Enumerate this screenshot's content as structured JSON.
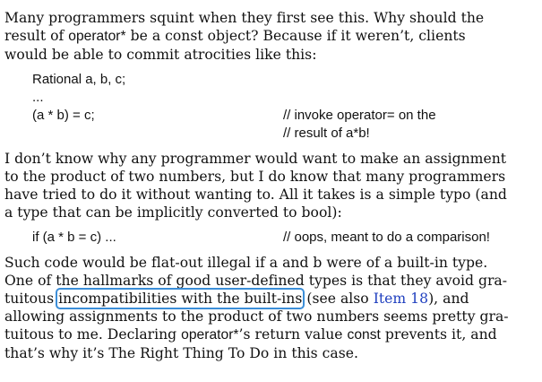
{
  "para1": {
    "l1": "Many programmers squint when they first see this. Why should the",
    "l2a": "result of ",
    "l2b": "operator*",
    "l2c": " be a const object? Because if it weren’t, clients",
    "l3": "would be able to commit atrocities like this:"
  },
  "code1": {
    "line1": "Rational a, b, c;",
    "line2": "...",
    "line3": "(a * b) = c;",
    "comment3": "// invoke operator= on the",
    "comment4": "// result of a*b!"
  },
  "para2": {
    "l1": "I don’t know why any programmer would want to make an assignment",
    "l2": "to the product of two numbers, but I do know that many programmers",
    "l3": "have tried to do it without wanting to. All it takes is a simple typo (and",
    "l4": "a type that can be implicitly converted to bool):"
  },
  "code2": {
    "line1": "if (a * b = c) ...",
    "comment1": "// oops, meant to do a comparison!"
  },
  "para3": {
    "l1": "Such code would be flat-out illegal if a and b were of a built-in type.",
    "l2": "One of the hallmarks of good user-defined types is that they avoid gra-",
    "l3a": "tuitous ",
    "l3b": "incompatibilities with the built-ins",
    "l3c": " (see also ",
    "l3d": "Item 18",
    "l3e": "), and",
    "l4": "allowing assignments to the product of two numbers seems pretty gra-",
    "l5a": "tuitous to me. Declaring ",
    "l5b": "operator*",
    "l5c": "’s return value ",
    "l5d": "const",
    "l5e": " prevents it, and",
    "l6": "that’s why it’s The Right Thing To Do in this case."
  }
}
